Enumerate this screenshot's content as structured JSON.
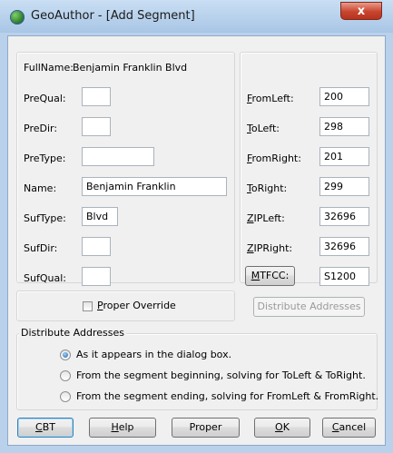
{
  "window": {
    "title": "GeoAuthor - [Add Segment]",
    "close_glyph": "x"
  },
  "left_panel": {
    "fullname_label": "FullName:",
    "fullname_value": "Benjamin Franklin Blvd",
    "fields": [
      {
        "label": "PreQual:",
        "value": ""
      },
      {
        "label": "PreDir:",
        "value": ""
      },
      {
        "label": "PreType:",
        "value": ""
      },
      {
        "label": "Name:",
        "value": "Benjamin Franklin"
      },
      {
        "label": "SufType:",
        "value": "Blvd"
      },
      {
        "label": "SufDir:",
        "value": ""
      },
      {
        "label": "SufQual:",
        "value": ""
      }
    ]
  },
  "right_panel": {
    "fields": [
      {
        "accel": "F",
        "rest": "romLeft:",
        "value": "200"
      },
      {
        "accel": "T",
        "rest": "oLeft:",
        "value": "298"
      },
      {
        "accel": "F",
        "rest": "romRight:",
        "value": "201"
      },
      {
        "accel": "T",
        "rest": "oRight:",
        "value": "299"
      },
      {
        "accel": "Z",
        "rest": "IPLeft:",
        "value": "32696"
      },
      {
        "accel": "Z",
        "rest": "IPRight:",
        "value": "32696"
      }
    ],
    "mtfcc_accel": "M",
    "mtfcc_rest": "TFCC:",
    "mtfcc_value": "S1200"
  },
  "proper_override": {
    "accel": "P",
    "rest": "roper Override",
    "checked": false
  },
  "distribute_button": "Distribute Addresses",
  "distribute_group": {
    "title": "Distribute Addresses",
    "options": [
      {
        "label": "As it appears in the dialog box.",
        "selected": true
      },
      {
        "label": "From the segment beginning, solving for ToLeft & ToRight.",
        "selected": false
      },
      {
        "label": "From the segment ending, solving for FromLeft & FromRight.",
        "selected": false
      }
    ]
  },
  "buttons": {
    "cbt_accel": "C",
    "cbt_rest": "BT",
    "help_accel": "H",
    "help_rest": "elp",
    "proper": "Proper",
    "ok_accel": "O",
    "ok_rest": "K",
    "cancel_accel": "C",
    "cancel_rest": "ancel"
  },
  "colors": {
    "frame": "#b9d1ea",
    "client": "#f0f0f0",
    "close_button": "#c7452f",
    "radio_selected": "#1f5fa8"
  },
  "icons": [
    "geoauthor-app-icon",
    "close-icon"
  ]
}
